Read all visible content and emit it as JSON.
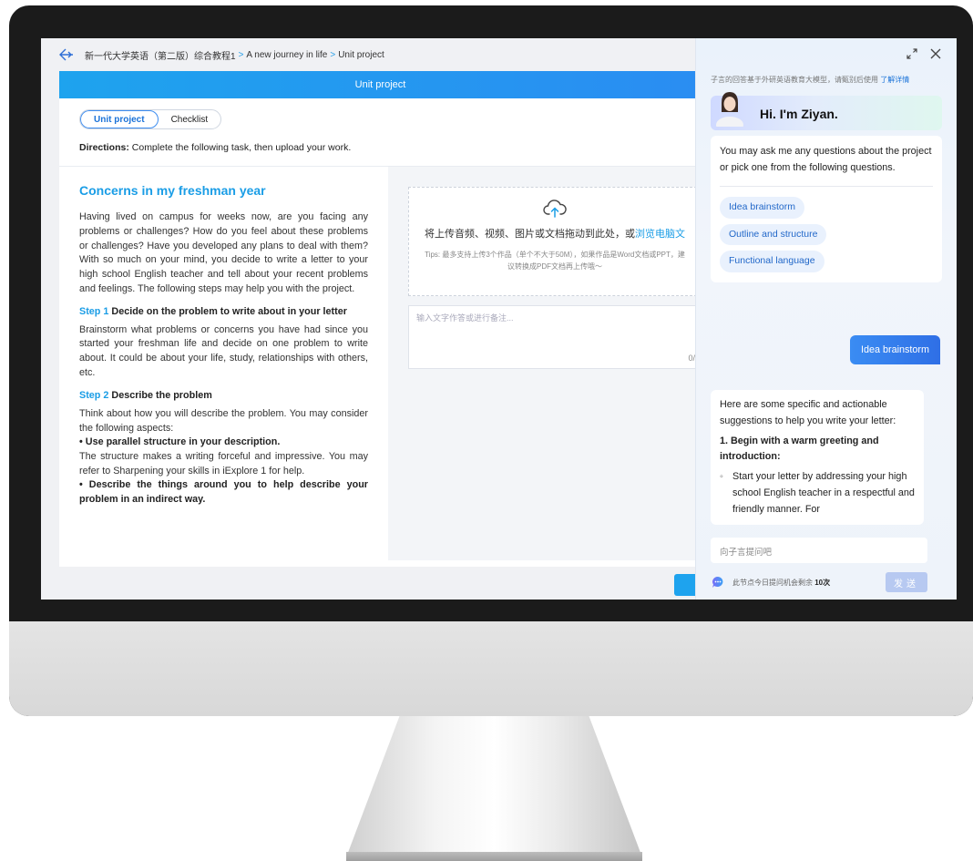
{
  "breadcrumb": {
    "course": "新一代大学英语（第二版）综合教程1",
    "unit": "A new journey in life",
    "page": "Unit project",
    "sep": ">"
  },
  "titlebar": {
    "title": "Unit project"
  },
  "tabs": [
    {
      "label": "Unit project",
      "active": true
    },
    {
      "label": "Checklist",
      "active": false
    }
  ],
  "directions": {
    "label": "Directions:",
    "text": "Complete the following task, then upload your work."
  },
  "content": {
    "heading": "Concerns in my freshman year",
    "intro": "Having lived on campus for weeks now, are you facing any problems or challenges? How do you feel about these problems or challenges? Have you developed any plans to deal with them? With so much on your mind, you decide to write a letter to your high school English teacher and tell about your recent problems and feelings. The following steps may help you with the project.",
    "step1": {
      "num": "Step 1",
      "title": "Decide on the problem to write about in your letter",
      "text": "Brainstorm what problems or concerns you have had since you started your freshman life and decide on one problem to write about. It could be about your life, study, relationships with others, etc."
    },
    "step2": {
      "num": "Step 2",
      "title": "Describe the problem",
      "text": "Think about how you will describe the problem. You may consider the following aspects:",
      "b1": "• Use parallel structure in your description.",
      "b1_text": "The structure makes a writing forceful and impressive. You may refer to Sharpening your skills in iExplore 1 for help.",
      "b2": "• Describe the things around you to help describe your problem in an indirect way."
    }
  },
  "upload": {
    "main": "将上传音频、视频、图片或文档拖动到此处，或",
    "link": "浏览电脑文",
    "tips": "Tips:  最多支持上传3个作品（单个不大于50M），如果作品是Word文档或PPT，建议转换成PDF文档再上传哦～"
  },
  "note": {
    "placeholder": "输入文字作答或进行备注...",
    "count": "0/"
  },
  "assistant": {
    "notice": "子言的回答基于外研英语教育大模型，请甄别后使用",
    "notice_link": "了解详情",
    "greeting": "Hi. I'm Ziyan.",
    "intro": "You may ask me any questions about the project or pick one from the following questions.",
    "chips": [
      "Idea brainstorm",
      "Outline and structure",
      "Functional language"
    ],
    "user_msg": "Idea brainstorm",
    "reply_intro": "Here are some specific and actionable suggestions to help you write your letter:",
    "reply_h1": "1. Begin with a warm greeting and introduction:",
    "reply_b1": "Start your letter by addressing your high school English teacher in a respectful and friendly manner. For",
    "input_placeholder": "向子言提问吧",
    "quota_prefix": "此节点今日提问机会剩余",
    "quota_count": "10次",
    "send_label": "发送"
  }
}
